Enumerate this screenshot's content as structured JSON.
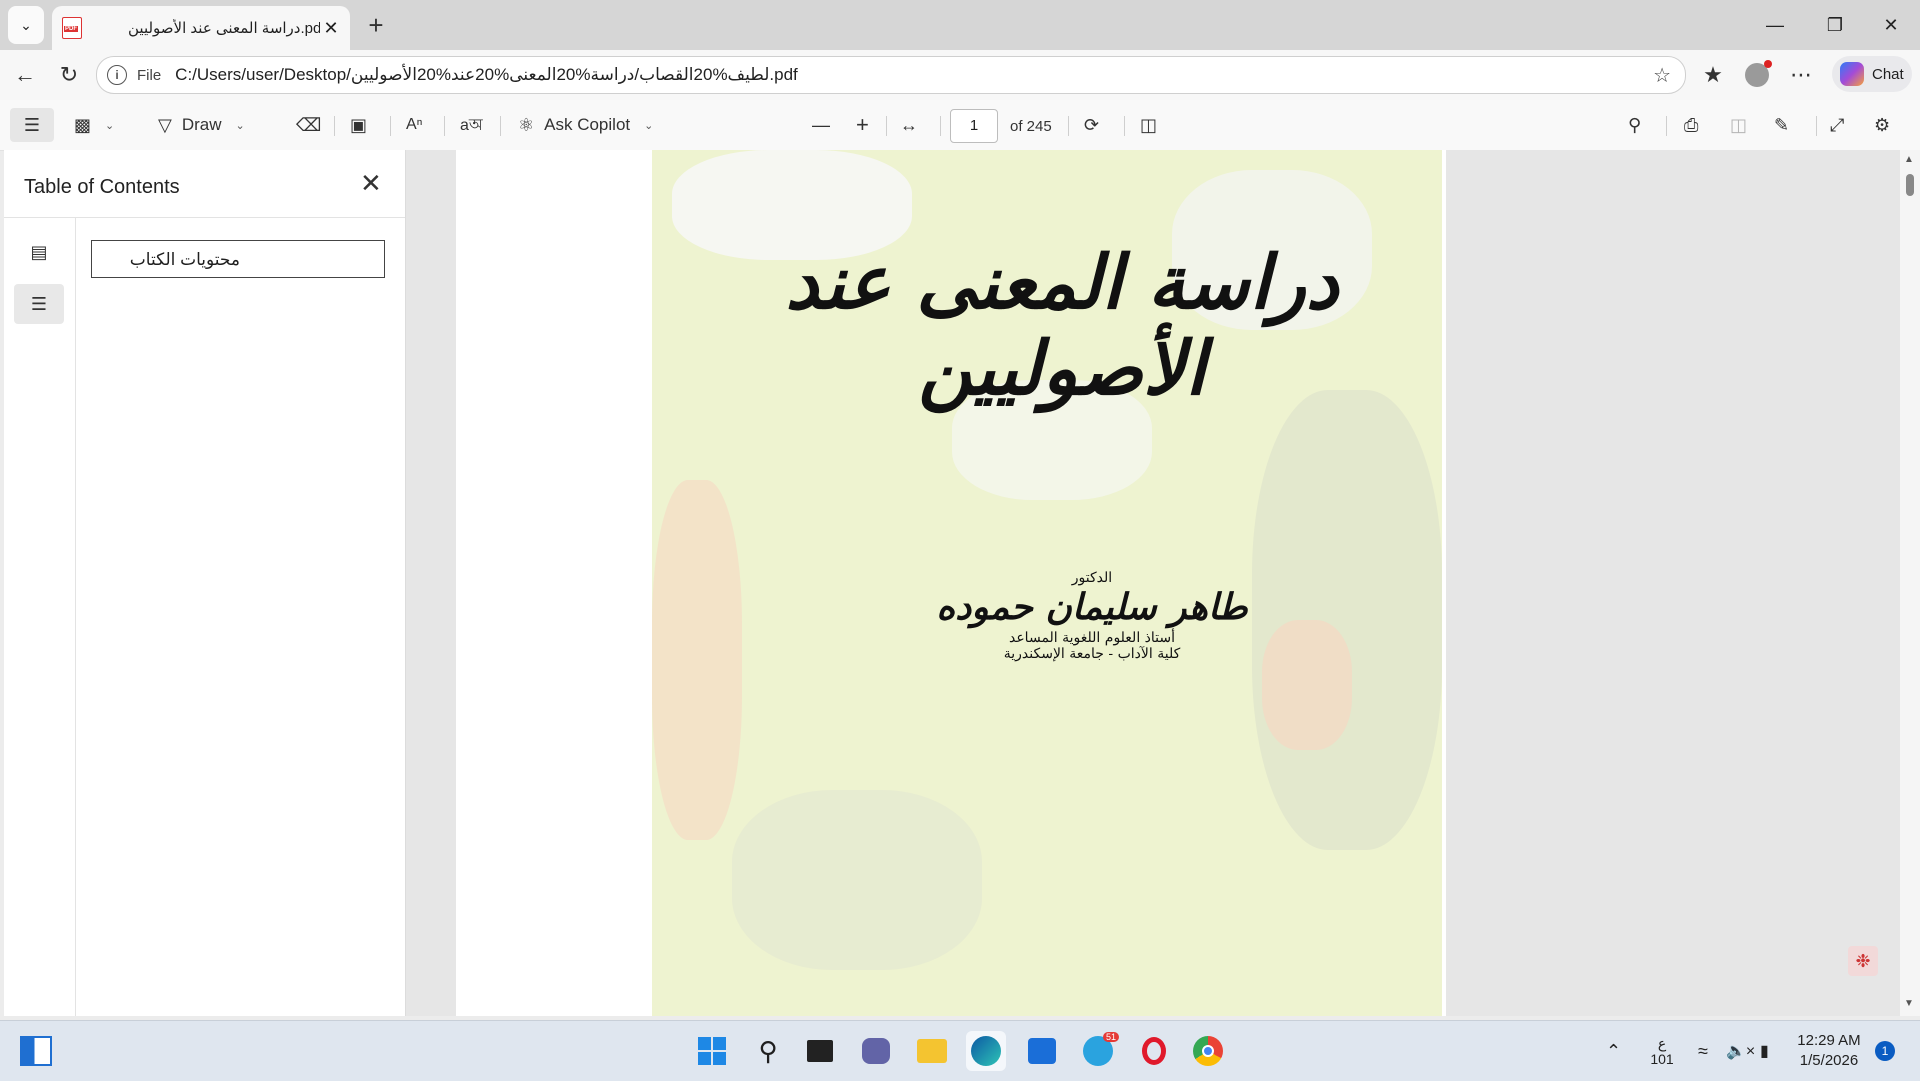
{
  "tab": {
    "title": "دراسة المعنى عند الأصوليين.pdf"
  },
  "address": {
    "scheme_label": "File",
    "url": "C:/Users/user/Desktop/لطيف%20القصاب/دراسة%20المعنى%20عند%20الأصوليين.pdf"
  },
  "chat": {
    "label": "Chat"
  },
  "toolbar": {
    "draw_label": "Draw",
    "copilot_label": "Ask Copilot",
    "page_number": "1",
    "page_count": "of 245"
  },
  "toc": {
    "title": "Table of Contents",
    "items": [
      {
        "label": "محتويات الكتاب"
      }
    ]
  },
  "document": {
    "title": "دراسة المعنى عند الأصوليين",
    "author_prefix": "الدكتور",
    "author": "طاهر سليمان حموده",
    "author_role": "أستاذ العلوم اللغوية المساعد",
    "author_affiliation": "كلية الآداب - جامعة الإسكندرية"
  },
  "taskbar": {
    "telegram_badge": "51",
    "lang_line1": "ع",
    "lang_line2": "101",
    "time": "12:29 AM",
    "date": "1/5/2026",
    "notification_count": "1"
  },
  "colors": {
    "accent": "#0a5cc2",
    "cover": "#eef3d0"
  }
}
